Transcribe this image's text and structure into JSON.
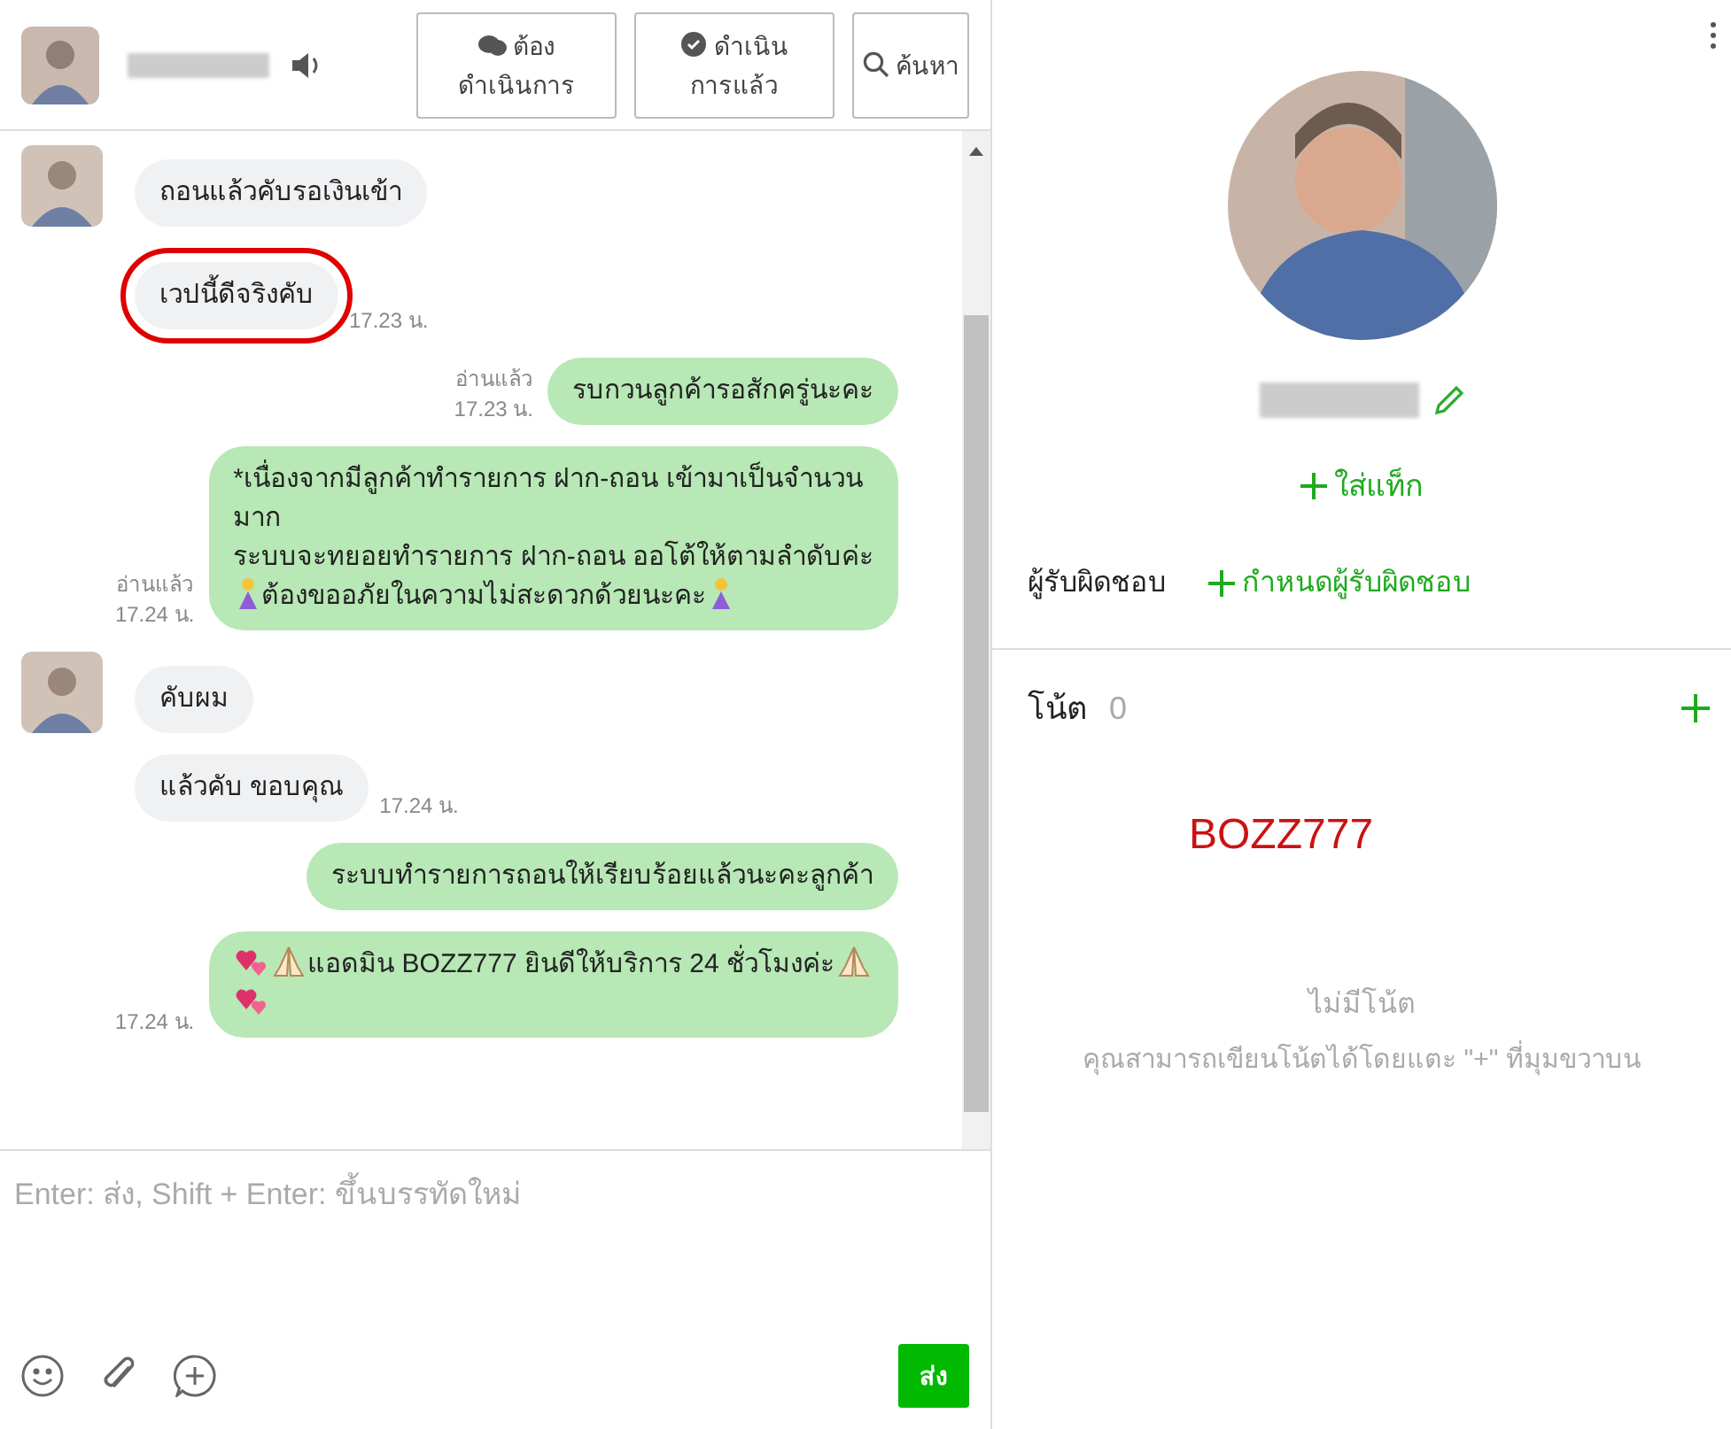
{
  "header": {
    "buttons": [
      {
        "kind": "chat",
        "label": "ต้อง\nดำเนินการ"
      },
      {
        "kind": "check",
        "label": "ดำเนิน\nการแล้ว"
      },
      {
        "kind": "search",
        "label": "ค้นหา"
      }
    ]
  },
  "messages": [
    {
      "kind": "in",
      "avatar": true,
      "highlighted": false,
      "parts": [
        {
          "kind": "text",
          "text": "ถอนแล้วคับรอเงินเข้า"
        }
      ]
    },
    {
      "kind": "in",
      "avatar": false,
      "highlighted": true,
      "time": "17.23 น.",
      "parts": [
        {
          "kind": "text",
          "text": "เวปนี้ดีจริงคับ"
        }
      ]
    },
    {
      "kind": "out",
      "read": "อ่านแล้ว",
      "time": "17.23 น.",
      "parts": [
        {
          "kind": "text",
          "text": "รบกวนลูกค้ารอสักครู่นะคะ"
        }
      ]
    },
    {
      "kind": "out",
      "read": "อ่านแล้ว",
      "time": "17.24 น.",
      "parts": [
        {
          "kind": "text",
          "text": "*เนื่องจากมีลูกค้าทำรายการ  ฝาก-ถอน เข้ามาเป็นจำนวน"
        },
        {
          "kind": "break"
        },
        {
          "kind": "text",
          "text": "มาก"
        },
        {
          "kind": "break"
        },
        {
          "kind": "text",
          "text": "ระบบจะทยอยทำรายการ  ฝาก-ถอน ออโต้ให้ตามลำดับค่ะ"
        },
        {
          "kind": "break"
        },
        {
          "kind": "bow"
        },
        {
          "kind": "text",
          "text": "ต้องขออภัยในความไม่สะดวกด้วยนะคะ"
        },
        {
          "kind": "bow"
        }
      ]
    },
    {
      "kind": "in",
      "avatar": true,
      "highlighted": false,
      "parts": [
        {
          "kind": "text",
          "text": "คับผม"
        }
      ]
    },
    {
      "kind": "in",
      "avatar": false,
      "highlighted": false,
      "time": "17.24 น.",
      "parts": [
        {
          "kind": "text",
          "text": "แล้วคับ ขอบคุณ"
        }
      ]
    },
    {
      "kind": "out",
      "parts": [
        {
          "kind": "text",
          "text": "ระบบทำรายการถอนให้เรียบร้อยแล้วนะคะลูกค้า"
        }
      ]
    },
    {
      "kind": "out",
      "time": "17.24 น.",
      "parts": [
        {
          "kind": "hearts"
        },
        {
          "kind": "pray"
        },
        {
          "kind": "text",
          "text": "แอดมิน BOZZ777 ยินดีให้บริการ 24 ชั่วโมงค่ะ"
        },
        {
          "kind": "pray"
        },
        {
          "kind": "break"
        },
        {
          "kind": "hearts"
        }
      ]
    }
  ],
  "composer": {
    "placeholder": "Enter: ส่ง, Shift + Enter: ขึ้นบรรทัดใหม่",
    "send": "ส่ง"
  },
  "profile": {
    "add_tag": "ใส่แท็ก",
    "assignee_label": "ผู้รับผิดชอบ",
    "assign": "กำหนดผู้รับผิดชอบ"
  },
  "notes": {
    "title": "โน้ต",
    "count": "0",
    "note": "BOZZ777",
    "empty_title": "ไม่มีโน้ต",
    "empty_hint": "คุณสามารถเขียนโน้ตได้โดยแตะ \"+\" ที่มุมขวาบน"
  }
}
